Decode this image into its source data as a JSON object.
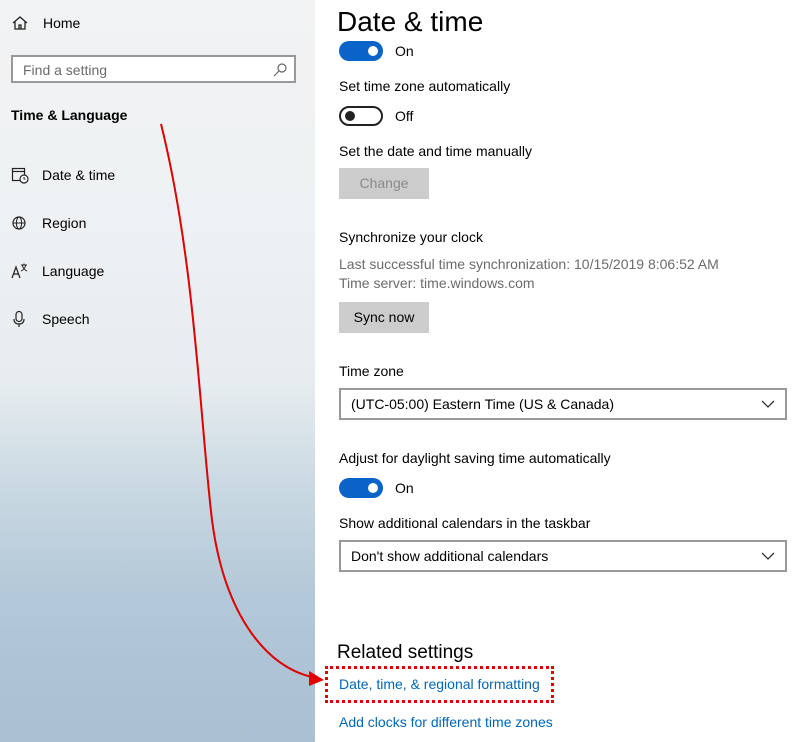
{
  "sidebar": {
    "home_label": "Home",
    "search_placeholder": "Find a setting",
    "section_title": "Time & Language",
    "items": [
      {
        "label": "Date & time",
        "icon": "calendar-clock-icon"
      },
      {
        "label": "Region",
        "icon": "globe-icon"
      },
      {
        "label": "Language",
        "icon": "language-icon"
      },
      {
        "label": "Speech",
        "icon": "microphone-icon"
      }
    ]
  },
  "main": {
    "title": "Date & time",
    "set_time_auto": {
      "state_label": "On",
      "on": true
    },
    "set_timezone_auto": {
      "label": "Set time zone automatically",
      "state_label": "Off",
      "on": false
    },
    "manual": {
      "label": "Set the date and time manually",
      "button": "Change"
    },
    "sync": {
      "label": "Synchronize your clock",
      "last_sync": "Last successful time synchronization: 10/15/2019 8:06:52 AM",
      "server": "Time server: time.windows.com",
      "button": "Sync now"
    },
    "time_zone": {
      "label": "Time zone",
      "value": "(UTC-05:00) Eastern Time (US & Canada)"
    },
    "daylight": {
      "label": "Adjust for daylight saving time automatically",
      "state_label": "On",
      "on": true
    },
    "calendars": {
      "label": "Show additional calendars in the taskbar",
      "value": "Don't show additional calendars"
    },
    "related": {
      "title": "Related settings",
      "links": [
        "Date, time, & regional formatting",
        "Add clocks for different time zones"
      ]
    }
  },
  "colors": {
    "accent": "#0a63c9",
    "link": "#0067b8",
    "annotation": "#e00000"
  }
}
